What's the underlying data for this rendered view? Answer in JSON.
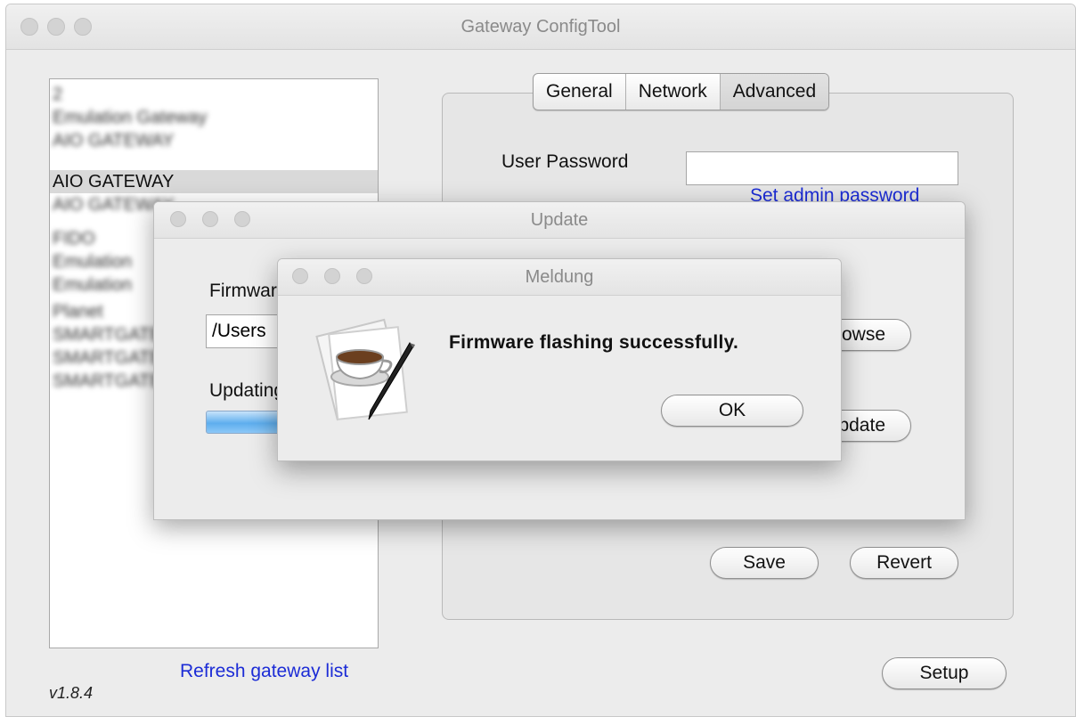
{
  "window": {
    "title": "Gateway ConfigTool"
  },
  "gateway_list": {
    "items": [
      {
        "label": "2"
      },
      {
        "label": "Emulation Gateway"
      },
      {
        "label": "AIO GATEWAY"
      },
      {
        "label": "AIO GATEWAY"
      },
      {
        "label": "AIO GATEWAY"
      },
      {
        "label": "FIDO"
      },
      {
        "label": "Emulation"
      },
      {
        "label": "Emulation"
      },
      {
        "label": "Planet"
      },
      {
        "label": "SMARTGATE"
      },
      {
        "label": "SMARTGATE"
      },
      {
        "label": "SMARTGATE"
      }
    ],
    "selected_index": 3
  },
  "refresh_link": "Refresh gateway list",
  "version": "v1.8.4",
  "tabs": [
    {
      "label": "General"
    },
    {
      "label": "Network"
    },
    {
      "label": "Advanced"
    }
  ],
  "active_tab": "Advanced",
  "advanced": {
    "user_password_label": "User Password",
    "user_password_value": "",
    "set_admin_link": "Set admin password",
    "save_label": "Save",
    "revert_label": "Revert"
  },
  "setup_label": "Setup",
  "update_dialog": {
    "title": "Update",
    "firmware_label": "Firmware",
    "firmware_path": "/Users",
    "browse_label": "Browse",
    "updating_label": "Updating",
    "update_label": "Update",
    "progress": 1.0
  },
  "message_dialog": {
    "title": "Meldung",
    "message": "Firmware flashing successfully.",
    "ok_label": "OK"
  }
}
